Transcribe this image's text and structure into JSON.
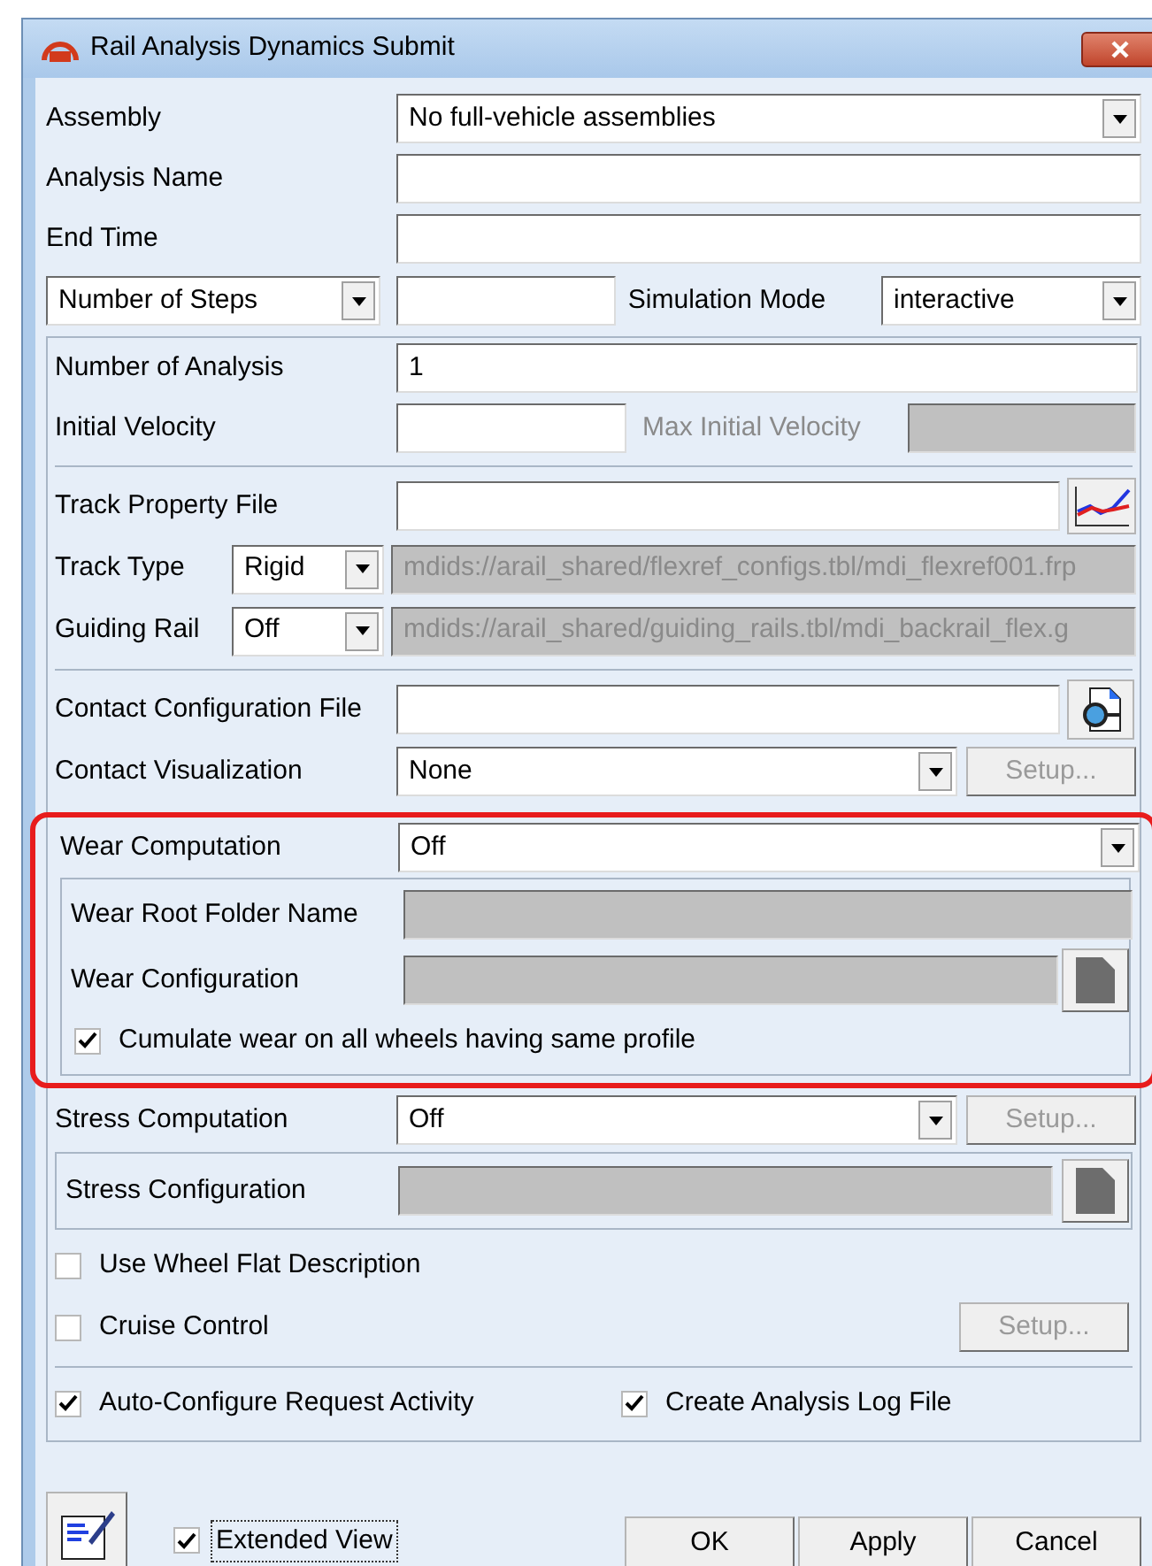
{
  "window": {
    "title": "Rail Analysis Dynamics Submit"
  },
  "assembly": {
    "label": "Assembly",
    "value": "No full-vehicle assemblies"
  },
  "analysis_name": {
    "label": "Analysis Name"
  },
  "end_time": {
    "label": "End Time"
  },
  "steps": {
    "value": "Number of Steps",
    "mode_label": "Simulation Mode",
    "mode_value": "interactive"
  },
  "number_of_analysis": {
    "label": "Number of Analysis",
    "value": "1"
  },
  "initial_velocity": {
    "label": "Initial Velocity",
    "max_label": "Max Initial Velocity",
    "max_disabled": true
  },
  "track_property_file": {
    "label": "Track Property File"
  },
  "track_type": {
    "label": "Track Type",
    "value": "Rigid",
    "path": "mdids://arail_shared/flexref_configs.tbl/mdi_flexref001.frp",
    "disabled": true
  },
  "guiding_rail": {
    "label": "Guiding Rail",
    "value": "Off",
    "path": "mdids://arail_shared/guiding_rails.tbl/mdi_backrail_flex.g",
    "disabled": true
  },
  "contact_configuration_file": {
    "label": "Contact Configuration File"
  },
  "contact_visualization": {
    "label": "Contact Visualization",
    "value": "None",
    "button": "Setup...",
    "button_disabled": true
  },
  "wear": {
    "highlighted": true,
    "label": "Wear Computation",
    "value": "Off",
    "root_label": "Wear Root Folder Name",
    "config_label": "Wear Configuration",
    "disabled": true,
    "cumulate": {
      "label": "Cumulate wear on all wheels having same profile",
      "checked": true
    }
  },
  "stress": {
    "label": "Stress Computation",
    "value": "Off",
    "button": "Setup...",
    "button_disabled": true,
    "config_label": "Stress Configuration",
    "disabled": true
  },
  "wheel_flat": {
    "label": "Use Wheel Flat Description",
    "checked": false
  },
  "cruise_control": {
    "label": "Cruise Control",
    "checked": false,
    "button": "Setup...",
    "button_disabled": true
  },
  "auto_configure": {
    "label": "Auto-Configure Request Activity",
    "checked": true
  },
  "log_file": {
    "label": "Create Analysis Log File",
    "checked": true
  },
  "extended_view": {
    "label": "Extended View",
    "checked": true
  },
  "buttons": [
    "OK",
    "Apply",
    "Cancel"
  ]
}
